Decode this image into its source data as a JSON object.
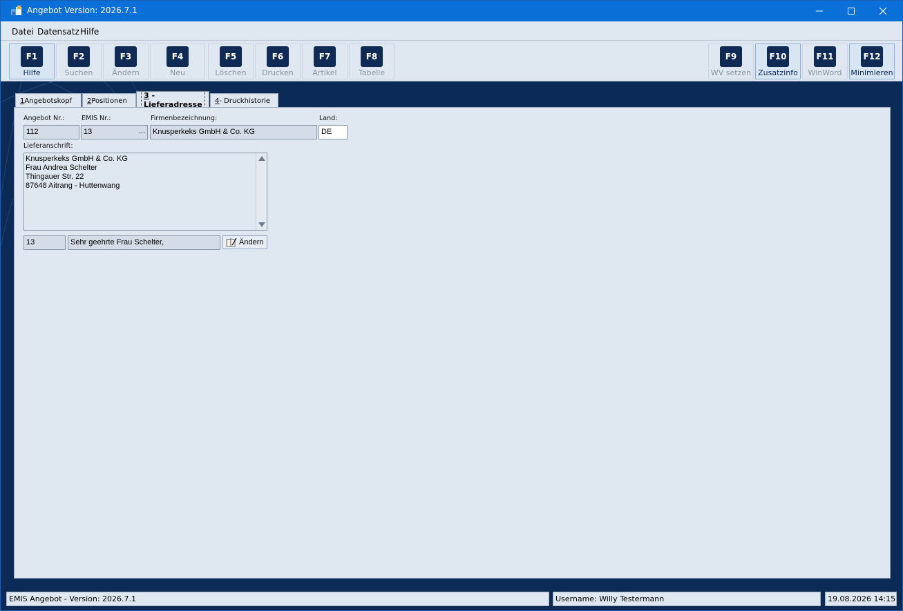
{
  "window": {
    "title": "Angebot Version: 2026.7.1"
  },
  "menu": {
    "items": [
      "Datei",
      "Datensatz",
      "Hilfe"
    ]
  },
  "toolbar": {
    "buttons": [
      {
        "key": "F1",
        "label": "Hilfe"
      },
      {
        "key": "F2",
        "label": "Suchen"
      },
      {
        "key": "F3",
        "label": "Ändern"
      },
      {
        "key": "F4",
        "label": "Neu"
      },
      {
        "key": "F5",
        "label": "Löschen"
      },
      {
        "key": "F6",
        "label": "Drucken"
      },
      {
        "key": "F7",
        "label": "Artikel"
      },
      {
        "key": "F8",
        "label": "Tabelle"
      },
      {
        "key": "F9",
        "label": "WV setzen"
      },
      {
        "key": "F10",
        "label": "Zusatzinfo"
      },
      {
        "key": "F11",
        "label": "WinWord"
      },
      {
        "key": "F12",
        "label": "Minimieren"
      }
    ]
  },
  "tabs": [
    {
      "num": "1",
      "label": " Angebotskopf"
    },
    {
      "num": "2",
      "label": " Positionen"
    },
    {
      "num": "3",
      "label": " - Lieferadresse"
    },
    {
      "num": "4",
      "label": " - Druckhistorie"
    }
  ],
  "form": {
    "angebot_nr_label": "Angebot Nr.:",
    "angebot_nr": "112",
    "emis_nr_label": "EMIS Nr.:",
    "emis_nr": "13",
    "emis_nr_button": "...",
    "firma_label": "Firmenbezeichnung:",
    "firma": "Knusperkeks GmbH & Co. KG",
    "land_label": "Land:",
    "land": "DE",
    "lieferanschrift_label": "Lieferanschrift:",
    "lieferanschrift": [
      "Knusperkeks GmbH & Co. KG",
      "Frau Andrea Schelter",
      "Thingauer Str. 22",
      "87648 Aitrang - Huttenwang"
    ],
    "anrede_nr": "13",
    "anrede": "Sehr geehrte Frau Schelter,",
    "aendern_button": "Ändern"
  },
  "status": {
    "version": "EMIS Angebot - Version: 2026.7.1",
    "user": "Username: Willy Testermann",
    "datetime": "19.08.2026 14:15"
  }
}
